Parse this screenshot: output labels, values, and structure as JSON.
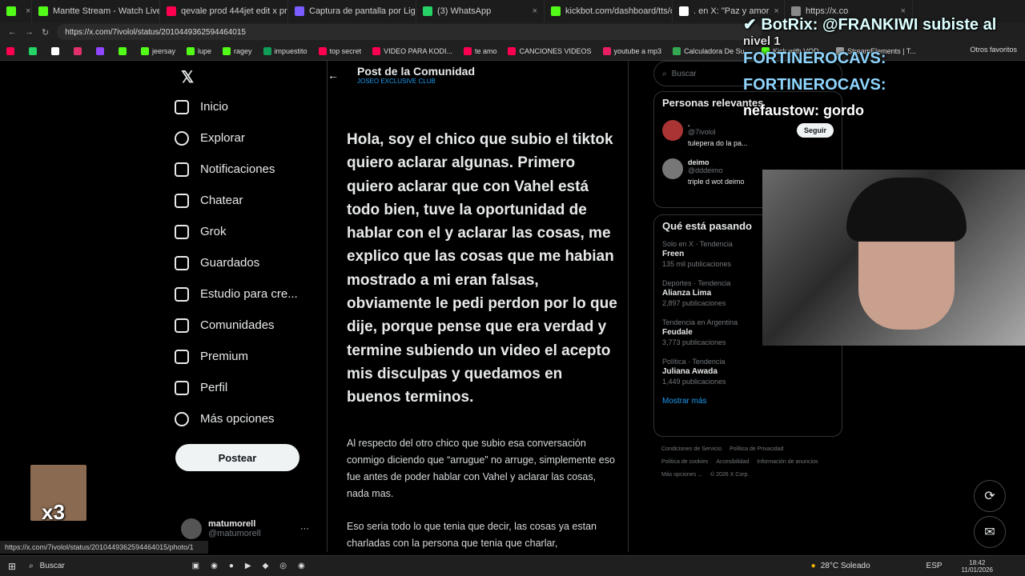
{
  "browser": {
    "tabs": [
      {
        "title": "",
        "color": "#53fc18"
      },
      {
        "title": "Mantte Stream - Watch Live o",
        "color": "#53fc18"
      },
      {
        "title": "qevale prod 444jet edit x proteccio",
        "color": "#ff0050"
      },
      {
        "title": "Captura de pantalla por Lightshot",
        "color": "#7a5cff"
      },
      {
        "title": "(3) WhatsApp",
        "color": "#25d366"
      },
      {
        "title": "kickbot.com/dashboard/tts/comm",
        "color": "#53fc18"
      },
      {
        "title": ". en X: \"Paz y amor",
        "color": "#ffffff"
      },
      {
        "title": "https://x.co",
        "color": "#888888"
      }
    ],
    "url": "https://x.com/7ivolol/status/2010449362594464015",
    "bookmarks": [
      {
        "label": "",
        "color": "#ff0050"
      },
      {
        "label": "",
        "color": "#25d366"
      },
      {
        "label": "",
        "color": "#ffffff"
      },
      {
        "label": "",
        "color": "#e1306c"
      },
      {
        "label": "",
        "color": "#9146ff"
      },
      {
        "label": "",
        "color": "#53fc18"
      },
      {
        "label": "jeersay",
        "color": "#53fc18"
      },
      {
        "label": "lupe",
        "color": "#53fc18"
      },
      {
        "label": "ragey",
        "color": "#53fc18"
      },
      {
        "label": "impuestito",
        "color": "#0f9d58"
      },
      {
        "label": "top secret",
        "color": "#ff0050"
      },
      {
        "label": "VIDEO PARA KODI...",
        "color": "#ff0050"
      },
      {
        "label": "te amo",
        "color": "#ff0050"
      },
      {
        "label": "CANCIONES VIDEOS",
        "color": "#ff0050"
      },
      {
        "label": "youtube a mp3",
        "color": "#e91e63"
      },
      {
        "label": "Calculadora De Su...",
        "color": "#34a853"
      },
      {
        "label": "Kick with VOD...",
        "color": "#53fc18"
      },
      {
        "label": "StreamElements | T...",
        "color": "#9a9a9a"
      }
    ],
    "other_bookmarks": "Otros favoritos",
    "status_url": "https://x.com/7ivolol/status/2010449362594464015/photo/1"
  },
  "nav": {
    "items": [
      {
        "label": "Inicio"
      },
      {
        "label": "Explorar"
      },
      {
        "label": "Notificaciones"
      },
      {
        "label": "Chatear"
      },
      {
        "label": "Grok"
      },
      {
        "label": "Guardados"
      },
      {
        "label": "Estudio para cre..."
      },
      {
        "label": "Comunidades"
      },
      {
        "label": "Premium"
      },
      {
        "label": "Perfil"
      },
      {
        "label": "Más opciones"
      }
    ],
    "post_button": "Postear",
    "profile_name": "matumorell",
    "profile_handle": "@matumorell"
  },
  "post": {
    "header_title": "Post de la Comunidad",
    "header_sub": "JOSEO EXCLUSIVE CLUB",
    "big_text": "Hola, soy el chico que subio el tiktok quiero aclarar algunas. Primero quiero aclarar que con Vahel está todo bien, tuve la oportunidad de hablar con el y aclarar las cosas, me explico que las cosas que me habian mostrado a mi eran falsas, obviamente le pedi perdon por lo que dije, porque pense que era verdad y termine subiendo un video el acepto mis disculpas y quedamos en buenos terminos.",
    "small_text_1": "Al respecto del otro chico que subio esa conversación conmigo diciendo que “arrugue” no arruge, simplemente eso fue antes de poder hablar con Vahel y aclarar las cosas, nada mas.",
    "small_text_2": "Eso seria todo lo que tenia que decir, las cosas ya estan charladas con la persona que tenia que charlar,"
  },
  "right": {
    "search_placeholder": "Buscar",
    "relevant_title": "Personas relevantes",
    "people": [
      {
        "name": ".",
        "handle": "@7ivolol",
        "bio": "tulepera do la pa..."
      },
      {
        "name": "deimo",
        "handle": "@dddeimo",
        "bio": "triple d wot deimo"
      }
    ],
    "follow_label": "Seguir",
    "trends_title": "Qué está pasando",
    "trends": [
      {
        "cat": "Solo en X · Tendencia",
        "name": "Freen",
        "count": "135 mil publicaciones"
      },
      {
        "cat": "Deportes · Tendencia",
        "name": "Alianza Lima",
        "count": "2,897 publicaciones"
      },
      {
        "cat": "Tendencia en Argentina",
        "name": "Feudale",
        "count": "3,773 publicaciones"
      },
      {
        "cat": "Política · Tendencia",
        "name": "Juliana Awada",
        "count": "1,449 publicaciones"
      }
    ],
    "show_more": "Mostrar más",
    "footer": [
      "Condiciones de Servicio",
      "Política de Privacidad",
      "Política de cookies",
      "Accesibilidad",
      "Información de anuncios",
      "Más opciones ...",
      "© 2026 X Corp."
    ]
  },
  "overlay": {
    "botrix": "BotRix: @FRANKIWI subiste al",
    "level": "nivel 1",
    "chat1": "FORTINEROCAVS:",
    "chat2": "FORTINEROCAVS:",
    "chat3": "nefaustow: gordo",
    "meme_text": "x3"
  },
  "taskbar": {
    "search": "Buscar",
    "weather": "28°C  Soleado",
    "lang": "ESP",
    "time": "18:42",
    "date": "11/01/2026"
  }
}
